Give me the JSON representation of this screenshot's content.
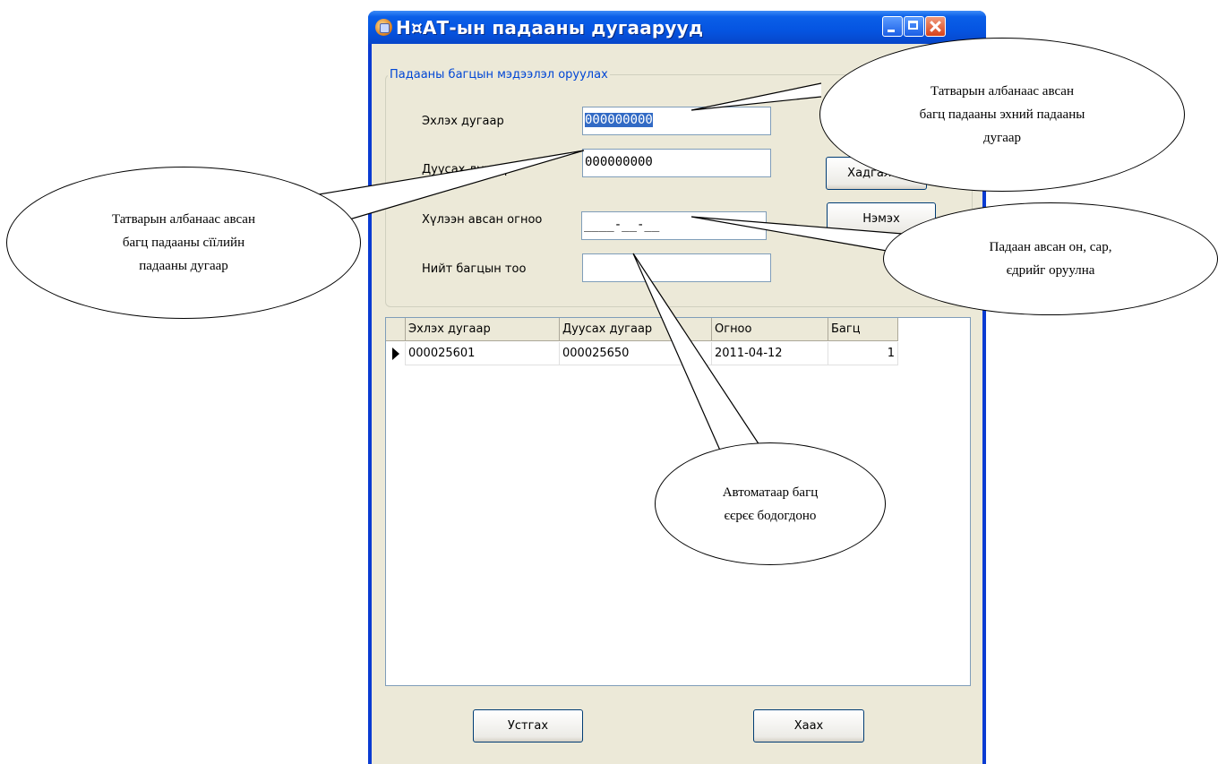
{
  "window": {
    "title": "Н¤АТ-ын падааны дугаарууд"
  },
  "form": {
    "group_caption": "Падааны багцын мэдээлэл оруулах",
    "start_label": "Эхлэх дугаар",
    "start_value": "000000000",
    "end_label": "Дуусах дугаар",
    "end_value": "000000000",
    "date_label": "Хүлээн авсан огноо",
    "date_value": "____-__-__",
    "total_label": "Нийт багцын тоо",
    "total_value": "",
    "save_button": "Хадгалах",
    "add_button": "Нэмэх"
  },
  "grid": {
    "columns": [
      "Эхлэх дугаар",
      "Дуусах дугаар",
      "Огноо",
      "Багц"
    ],
    "rows": [
      [
        "000025601",
        "000025650",
        "2011-04-12",
        "1"
      ]
    ]
  },
  "footer": {
    "delete_button": "Устгах",
    "close_button": "Хаах"
  },
  "callouts": {
    "start_number": "Татварын албанаас авсан\nбагц падааны эхний падааны\nдугаар",
    "end_number": "Татварын албанаас авсан\nбагц падааны сїїлийн\nпадааны дугаар",
    "date": "Падаан авсан он, сар,\nєдрийг оруулна",
    "auto_count": "Автоматаар багц\nєєрєє бодогдоно"
  }
}
